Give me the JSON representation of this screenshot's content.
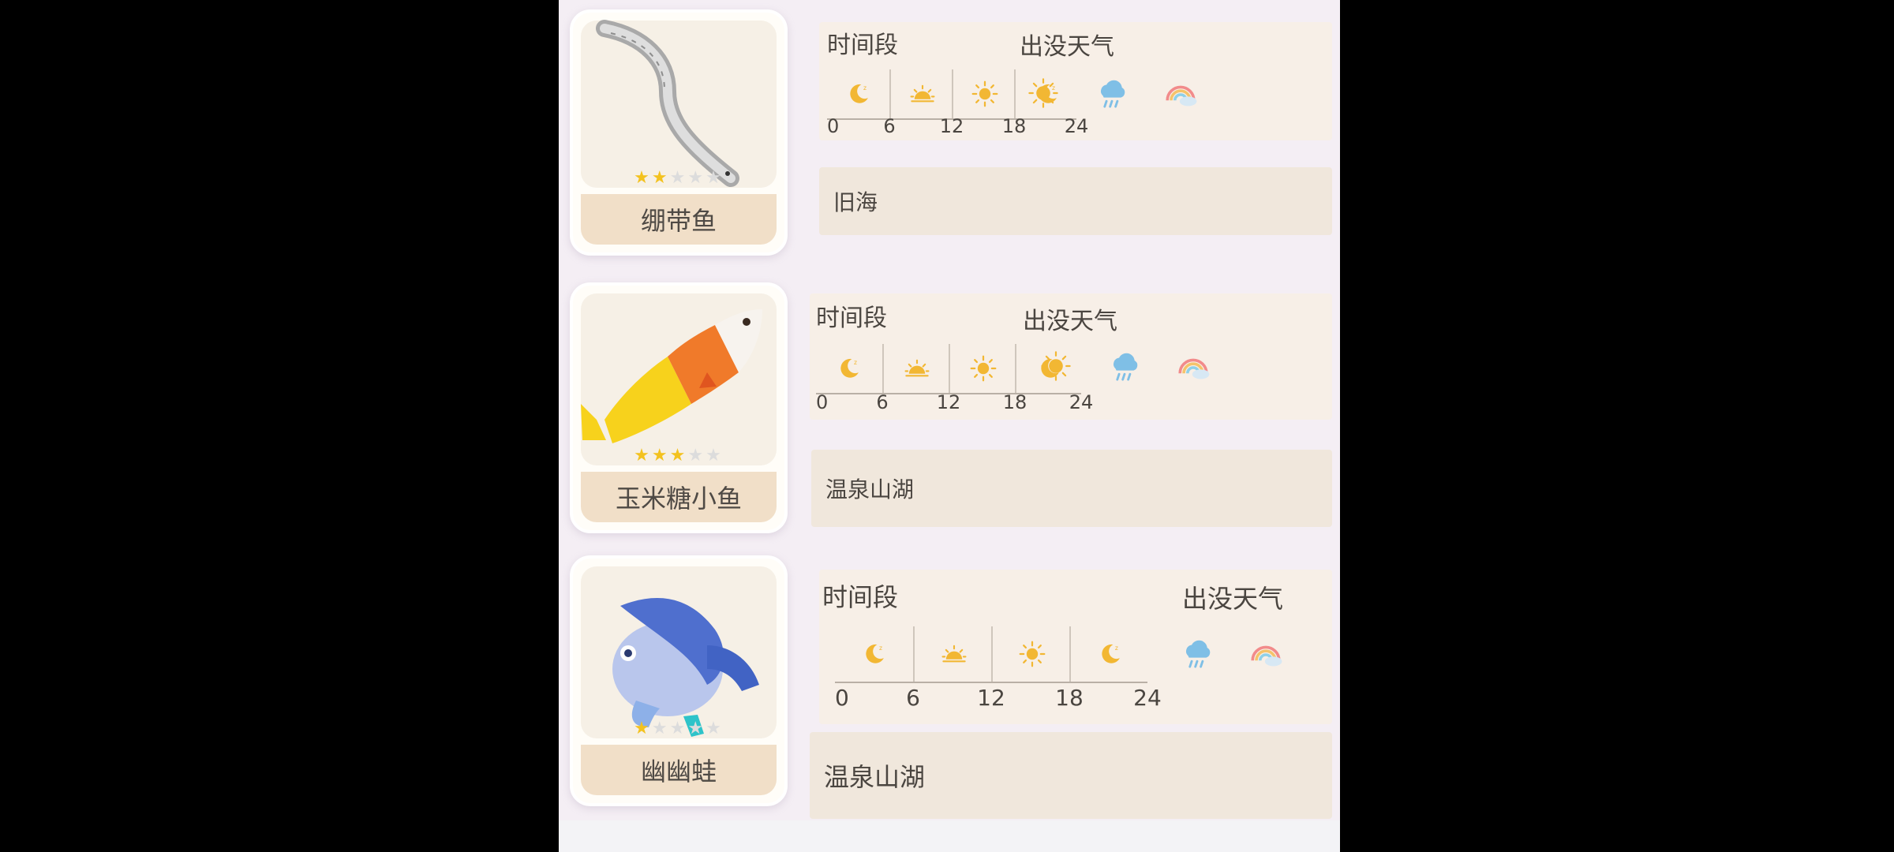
{
  "creatures": [
    {
      "name": "绷带鱼",
      "stars_filled": 2,
      "stars_total": 5,
      "time_label": "时间段",
      "time_ticks": [
        "0",
        "6",
        "12",
        "18",
        "24"
      ],
      "time_icons": [
        "moon-icon",
        "sunrise-icon",
        "sun-icon",
        "moon-icon"
      ],
      "weather_label": "出没天气",
      "weather_icons": [
        "sunny-icon",
        "rain-icon",
        "rainbow-icon"
      ],
      "location": "旧海"
    },
    {
      "name": "玉米糖小鱼",
      "stars_filled": 3,
      "stars_total": 5,
      "time_label": "时间段",
      "time_ticks": [
        "0",
        "6",
        "12",
        "18",
        "24"
      ],
      "time_icons": [
        "moon-icon",
        "sunrise-icon",
        "sun-icon",
        "moon-icon"
      ],
      "weather_label": "出没天气",
      "weather_icons": [
        "sunny-icon",
        "rain-icon",
        "rainbow-icon"
      ],
      "location": "温泉山湖"
    },
    {
      "name": "幽幽蛙",
      "stars_filled": 1,
      "stars_total": 5,
      "time_label": "时间段",
      "time_ticks": [
        "0",
        "6",
        "12",
        "18",
        "24"
      ],
      "time_icons": [
        "moon-icon",
        "sunrise-icon",
        "sun-icon",
        "moon-icon"
      ],
      "weather_label": "出没天气",
      "weather_icons": [
        "rain-icon",
        "rainbow-icon"
      ],
      "location": "温泉山湖"
    }
  ],
  "colors": {
    "star_on": "#f3c21f",
    "star_off": "#dcdcdc",
    "icon_sun": "#f2b733",
    "icon_rain": "#7fbfe6",
    "name_plate": "#f1dfc8"
  }
}
